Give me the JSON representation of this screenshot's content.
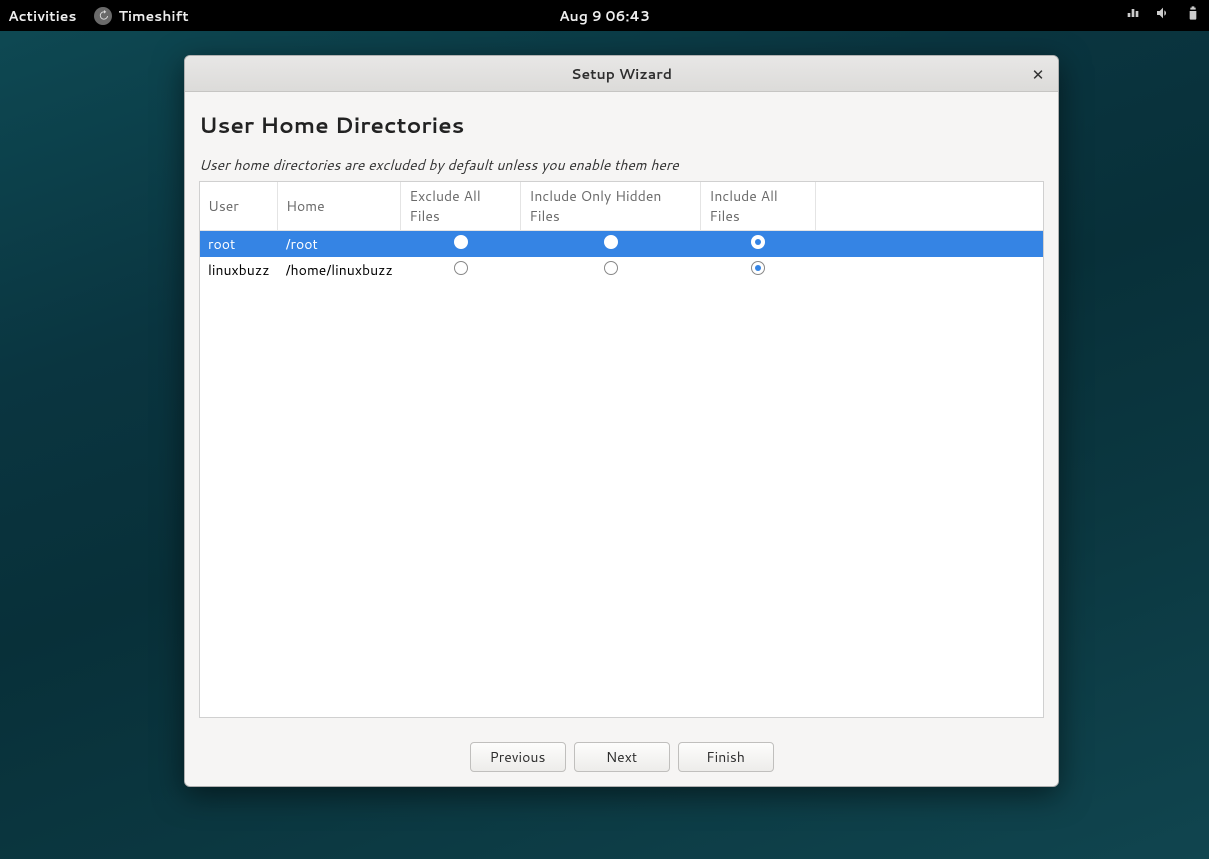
{
  "topbar": {
    "activities": "Activities",
    "app_name": "Timeshift",
    "datetime": "Aug 9  06:43"
  },
  "window": {
    "title": "Setup Wizard",
    "page_title": "User Home Directories",
    "subtitle": "User home directories are excluded by default unless you enable them here",
    "columns": {
      "user": "User",
      "home": "Home",
      "exclude": "Exclude All Files",
      "hidden": "Include Only Hidden Files",
      "all": "Include All Files"
    },
    "rows": [
      {
        "user": "root",
        "home": "/root",
        "selected": true,
        "choice": "all"
      },
      {
        "user": "linuxbuzz",
        "home": "/home/linuxbuzz",
        "selected": false,
        "choice": "all"
      }
    ],
    "buttons": {
      "previous": "Previous",
      "next": "Next",
      "finish": "Finish"
    }
  }
}
